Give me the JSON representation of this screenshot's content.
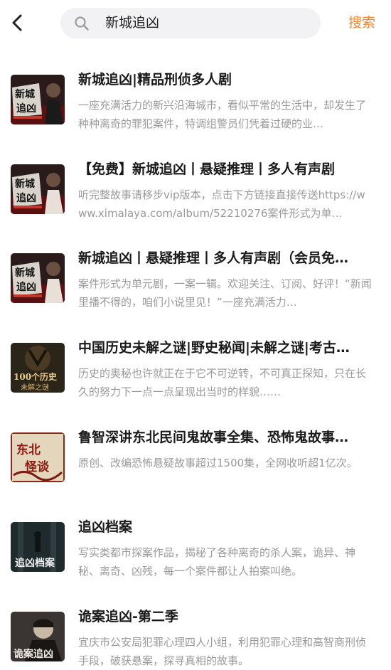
{
  "header": {
    "back_icon": "chevron-left-icon",
    "search_icon": "search-icon",
    "search_value": "新城追凶",
    "search_button_label": "搜索",
    "accent_color": "#f5862e"
  },
  "results": [
    {
      "title": "新城追凶|精品刑侦多人剧",
      "description": "一座充满活力的新兴沿海城市，看似平常的生活中，却发生了种种离奇的罪犯案件，特调组警员们凭着过硬的业…",
      "cover_text": [
        "新城",
        "追凶"
      ]
    },
    {
      "title": "【免费】新城追凶丨悬疑推理丨多人有声剧",
      "description": "听完整故事请移步vip版本，点击下方链接直接传送https://www.ximalaya.com/album/52210276案件形式为单…",
      "cover_text": [
        "新城",
        "追凶"
      ]
    },
    {
      "title": "新城追凶丨悬疑推理丨多人有声剧（会员免…",
      "description": "案件形式为单元剧，一案一辑。欢迎关注、订阅、好评！“新闻里播不得的，咱们小说里见！”一座充满活力…",
      "cover_text": [
        "新城",
        "追凶"
      ]
    },
    {
      "title": "中国历史未解之谜|野史秘闻|未解之谜|考古…",
      "description": "历史的奥秘也许就正在于它不可逆转，不可真正探知，只在长久的努力下一点一点呈现出当时的样貌……",
      "cover_text": [
        "100个历史",
        "未解之谜"
      ]
    },
    {
      "title": "鲁智深讲东北民间鬼故事全集、恐怖鬼故事…",
      "description": "原创、改编恐怖悬疑故事超过1500集，全网收听超1亿次。",
      "cover_text": [
        "东北",
        "怪谈"
      ]
    },
    {
      "title": "追凶档案",
      "description": "写实类都市探案作品，揭秘了各种离奇的杀人案，诡异、神秘、离奇、凶残，每一个案件都让人拍案叫绝。",
      "cover_text": [
        "追凶档案"
      ]
    },
    {
      "title": "诡案追凶-第二季",
      "description": "宜庆市公安局犯罪心理四人小组，利用犯罪心理和高智商刑侦手段，破获悬案，探寻真相的故事。",
      "cover_text": [
        "诡案追凶"
      ]
    }
  ]
}
